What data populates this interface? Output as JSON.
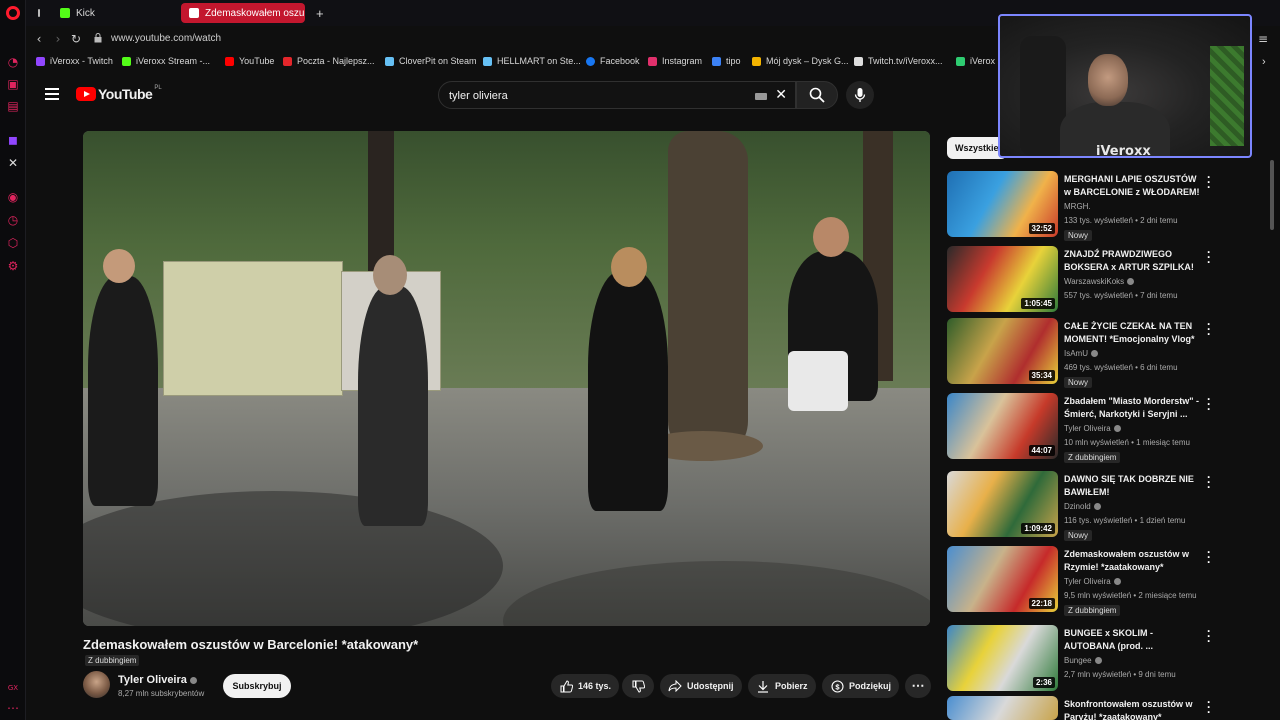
{
  "browser": {
    "tabs": [
      {
        "label": "Kick",
        "color": "#53fc18"
      },
      {
        "label": "Zdemaskowałem oszu",
        "color": "#ffffff"
      }
    ],
    "url": "www.youtube.com/watch",
    "bookmarks": [
      {
        "label": "iVeroxx - Twitch",
        "color": "#9146ff"
      },
      {
        "label": "iVeroxx Stream -...",
        "color": "#53fc18"
      },
      {
        "label": "YouTube",
        "color": "#ff0000"
      },
      {
        "label": "Poczta - Najlepsz...",
        "color": "#e4262b"
      },
      {
        "label": "CloverPit on Steam",
        "color": "#66c0f4"
      },
      {
        "label": "HELLMART on Ste...",
        "color": "#66c0f4"
      },
      {
        "label": "Facebook",
        "color": "#1877f2"
      },
      {
        "label": "Instagram",
        "color": "#e1306c"
      },
      {
        "label": "tipo",
        "color": "#3c82f6"
      },
      {
        "label": "Mój dysk – Dysk G...",
        "color": "#f4b400"
      },
      {
        "label": "Twitch.tv/iVeroxx...",
        "color": "#dddddd"
      },
      {
        "label": "iVerox",
        "color": "#2ecc71"
      }
    ]
  },
  "youtube": {
    "logo_text": "YouTube",
    "region": "PL",
    "search_query": "tyler oliviera"
  },
  "video": {
    "title": "Zdemaskowałem oszustów w Barcelonie! *atakowany*",
    "dubbing": "Z dubbingiem",
    "channel": "Tyler Oliveira",
    "subscribers": "8,27 mln subskrybentów",
    "subscribe_label": "Subskrybuj",
    "likes": "146 tys.",
    "share_label": "Udostępnij",
    "download_label": "Pobierz",
    "thanks_label": "Podziękuj"
  },
  "overlay": {
    "streamer_name": "iVeroxx"
  },
  "chips": {
    "all_label": "Wszystkie"
  },
  "recommendations": [
    {
      "title": "MERGHANI LAPIE OSZUSTÓW w BARCELONIE z WŁODAREM!",
      "channel": "MRGH.",
      "meta": "133 tys. wyświetleń • 2 dni temu",
      "badge": "Nowy",
      "duration": "32:52",
      "verified": false
    },
    {
      "title": "ZNAJDŹ PRAWDZIWEGO BOKSERA x ARTUR SZPILKA!",
      "channel": "WarszawskiKoks",
      "meta": "557 tys. wyświetleń • 7 dni temu",
      "badge": "",
      "duration": "1:05:45",
      "verified": true
    },
    {
      "title": "CAŁE ŻYCIE CZEKAŁ NA TEN MOMENT! *Emocjonalny Vlog*",
      "channel": "IsAmU",
      "meta": "469 tys. wyświetleń • 6 dni temu",
      "badge": "Nowy",
      "duration": "35:34",
      "verified": true
    },
    {
      "title": "Zbadałem \"Miasto Morderstw\" - Śmierć, Narkotyki i Seryjni ...",
      "channel": "Tyler Oliveira",
      "meta": "10 mln wyświetleń • 1 miesiąc temu",
      "badge": "Z dubbingiem",
      "duration": "44:07",
      "verified": true
    },
    {
      "title": "DAWNO SIĘ TAK DOBRZE NIE BAWIŁEM!",
      "channel": "Dzinold",
      "meta": "116 tys. wyświetleń • 1 dzień temu",
      "badge": "Nowy",
      "duration": "1:09:42",
      "verified": true
    },
    {
      "title": "Zdemaskowałem oszustów w Rzymie! *zaatakowany*",
      "channel": "Tyler Oliveira",
      "meta": "9,5 mln wyświetleń • 2 miesiące temu",
      "badge": "Z dubbingiem",
      "duration": "22:18",
      "verified": true
    },
    {
      "title": "BUNGEE x SKOLIM - AUTOBANA (prod. ...",
      "channel": "Bungee",
      "meta": "2,7 mln wyświetleń • 9 dni temu",
      "badge": "",
      "duration": "2:36",
      "verified": true
    },
    {
      "title": "Skonfrontowałem oszustów w Paryżu! *zaatakowany*",
      "channel": "",
      "meta": "",
      "badge": "",
      "duration": "",
      "verified": false
    }
  ],
  "colors": {
    "accent": "#ff0000",
    "opera_red": "#ff1b2d",
    "background": "#0f0f0f",
    "active_tab": "#c3172e"
  }
}
